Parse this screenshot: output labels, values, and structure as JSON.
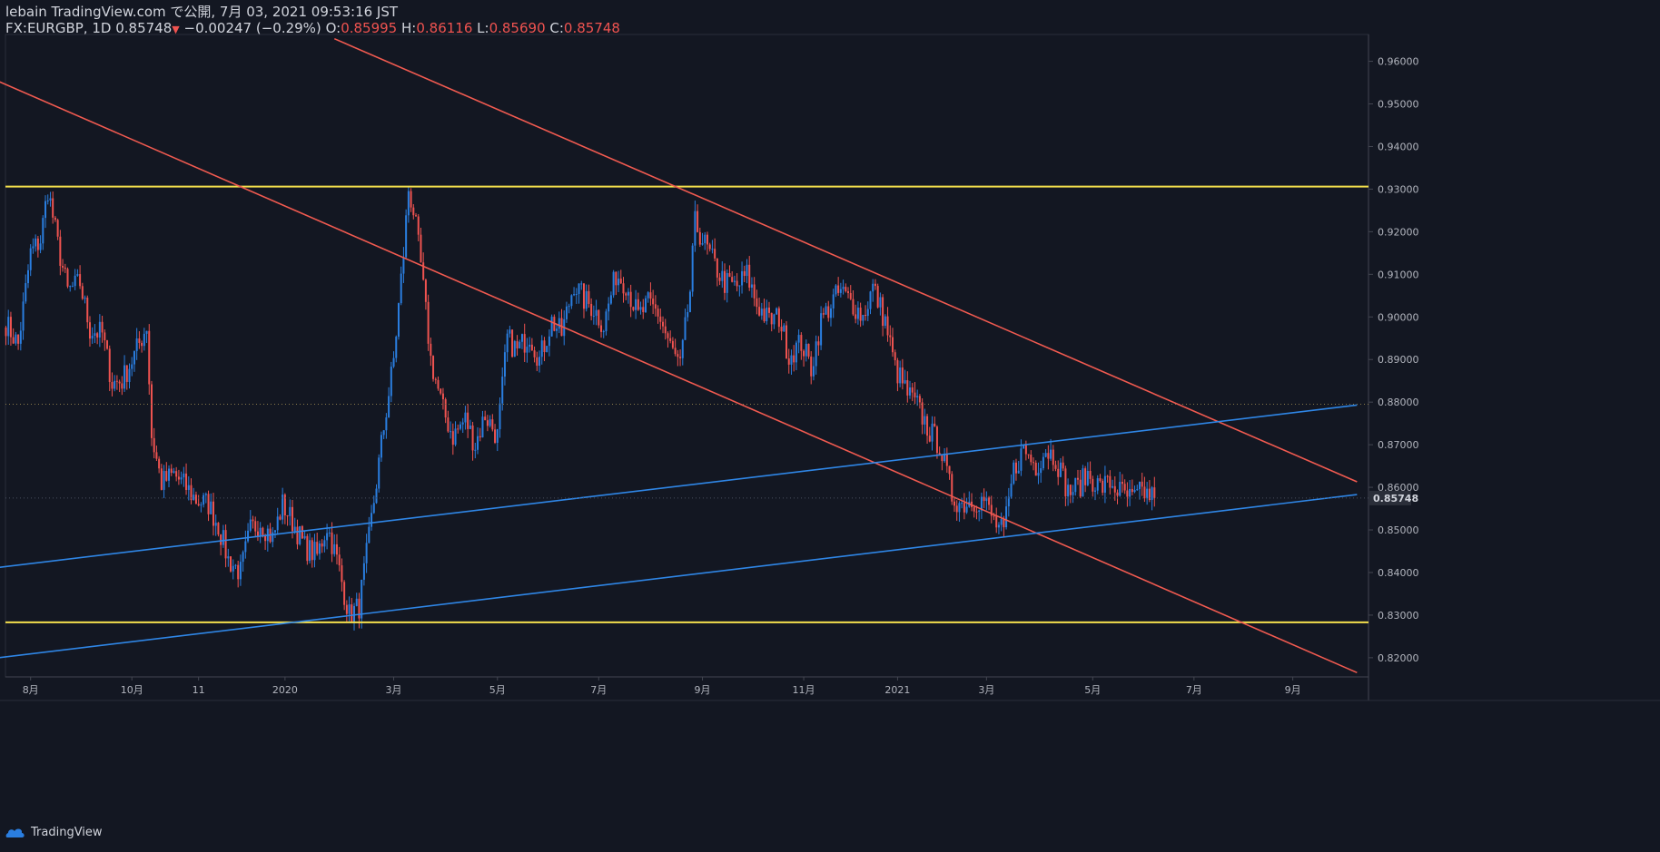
{
  "header": {
    "line1": "lebain TradingView.com で公開, 7月 03, 2021 09:53:16 JST",
    "symbol": "FX:EURGBP, 1D",
    "last": "0.85748",
    "arrow": "▼",
    "change": "−0.00247 (−0.29%)",
    "o_label": "O:",
    "o_value": "0.85995",
    "h_label": "H:",
    "h_value": "0.86116",
    "l_label": "L:",
    "l_value": "0.85690",
    "c_label": "C:",
    "c_value": "0.85748"
  },
  "footer": {
    "brand": "TradingView"
  },
  "colors": {
    "background": "#131722",
    "up": "#2a7ee0",
    "down": "#ef5350",
    "yellow": "#f4e04d",
    "blueLine": "#2f86e6",
    "redLine": "#f05a50",
    "axisText": "#b2b5be"
  },
  "chart_data": {
    "type": "candlestick",
    "symbol": "FX:EURGBP",
    "interval": "1D",
    "ylim": [
      0.8155,
      0.9663
    ],
    "y_ticks": [
      "0.96000",
      "0.95000",
      "0.94000",
      "0.93000",
      "0.92000",
      "0.91000",
      "0.90000",
      "0.89000",
      "0.88000",
      "0.87000",
      "0.86000",
      "0.85000",
      "0.84000",
      "0.83000",
      "0.82000"
    ],
    "x_ticks": [
      "8月",
      "10月",
      "11",
      "2020",
      "3月",
      "5月",
      "7月",
      "9月",
      "11月",
      "2021",
      "3月",
      "5月",
      "7月",
      "9月"
    ],
    "last_price_label": "0.85748",
    "series_points": [
      [
        0,
        0.8985
      ],
      [
        5,
        0.8935
      ],
      [
        10,
        0.915
      ],
      [
        14,
        0.918
      ],
      [
        17,
        0.93
      ],
      [
        21,
        0.917
      ],
      [
        25,
        0.906
      ],
      [
        30,
        0.908
      ],
      [
        34,
        0.897
      ],
      [
        39,
        0.896
      ],
      [
        43,
        0.8845
      ],
      [
        47,
        0.885
      ],
      [
        52,
        0.891
      ],
      [
        57,
        0.898
      ],
      [
        59,
        0.872
      ],
      [
        63,
        0.861
      ],
      [
        68,
        0.863
      ],
      [
        73,
        0.86
      ],
      [
        77,
        0.857
      ],
      [
        82,
        0.856
      ],
      [
        86,
        0.851
      ],
      [
        90,
        0.843
      ],
      [
        95,
        0.84
      ],
      [
        99,
        0.85
      ],
      [
        103,
        0.852
      ],
      [
        108,
        0.848
      ],
      [
        112,
        0.856
      ],
      [
        116,
        0.852
      ],
      [
        121,
        0.846
      ],
      [
        126,
        0.844
      ],
      [
        130,
        0.851
      ],
      [
        134,
        0.843
      ],
      [
        139,
        0.83
      ],
      [
        143,
        0.832
      ],
      [
        147,
        0.848
      ],
      [
        152,
        0.87
      ],
      [
        157,
        0.89
      ],
      [
        161,
        0.915
      ],
      [
        163,
        0.93
      ],
      [
        165,
        0.925
      ],
      [
        168,
        0.912
      ],
      [
        172,
        0.89
      ],
      [
        177,
        0.878
      ],
      [
        181,
        0.872
      ],
      [
        186,
        0.876
      ],
      [
        190,
        0.87
      ],
      [
        194,
        0.877
      ],
      [
        199,
        0.872
      ],
      [
        203,
        0.895
      ],
      [
        207,
        0.892
      ],
      [
        212,
        0.896
      ],
      [
        216,
        0.89
      ],
      [
        221,
        0.899
      ],
      [
        225,
        0.896
      ],
      [
        230,
        0.908
      ],
      [
        234,
        0.904
      ],
      [
        238,
        0.902
      ],
      [
        242,
        0.898
      ],
      [
        247,
        0.91
      ],
      [
        251,
        0.908
      ],
      [
        256,
        0.9
      ],
      [
        260,
        0.903
      ],
      [
        264,
        0.901
      ],
      [
        269,
        0.893
      ],
      [
        273,
        0.888
      ],
      [
        277,
        0.906
      ],
      [
        279,
        0.922
      ],
      [
        283,
        0.917
      ],
      [
        287,
        0.912
      ],
      [
        291,
        0.908
      ],
      [
        296,
        0.907
      ],
      [
        300,
        0.91
      ],
      [
        304,
        0.903
      ],
      [
        309,
        0.899
      ],
      [
        313,
        0.9
      ],
      [
        317,
        0.891
      ],
      [
        322,
        0.894
      ],
      [
        326,
        0.888
      ],
      [
        330,
        0.899
      ],
      [
        335,
        0.904
      ],
      [
        338,
        0.906
      ],
      [
        343,
        0.903
      ],
      [
        347,
        0.9
      ],
      [
        351,
        0.907
      ],
      [
        356,
        0.899
      ],
      [
        360,
        0.888
      ],
      [
        365,
        0.882
      ],
      [
        369,
        0.879
      ],
      [
        374,
        0.873
      ],
      [
        378,
        0.87
      ],
      [
        383,
        0.858
      ],
      [
        387,
        0.856
      ],
      [
        391,
        0.857
      ],
      [
        396,
        0.857
      ],
      [
        400,
        0.852
      ],
      [
        404,
        0.849
      ],
      [
        408,
        0.864
      ],
      [
        412,
        0.869
      ],
      [
        417,
        0.865
      ],
      [
        421,
        0.869
      ],
      [
        425,
        0.867
      ],
      [
        430,
        0.859
      ],
      [
        434,
        0.86
      ],
      [
        438,
        0.863
      ],
      [
        443,
        0.86
      ],
      [
        447,
        0.861
      ],
      [
        451,
        0.859
      ],
      [
        456,
        0.857
      ],
      [
        460,
        0.859
      ],
      [
        465,
        0.8575
      ]
    ],
    "horizontal_lines": [
      {
        "name": "resistance",
        "price": 0.9306,
        "color": "yellow"
      },
      {
        "name": "support",
        "price": 0.8283,
        "color": "yellow"
      },
      {
        "name": "reference",
        "price": 0.8795,
        "style": "dotted"
      }
    ],
    "trend_lines": [
      {
        "color": "red",
        "from": [
          -3,
          0.9553
        ],
        "to": [
          547,
          0.8165
        ]
      },
      {
        "color": "red",
        "from": [
          133,
          0.9653
        ],
        "to": [
          547,
          0.8613
        ]
      },
      {
        "color": "blue",
        "from": [
          -3,
          0.8412
        ],
        "to": [
          547,
          0.8793
        ]
      },
      {
        "color": "blue",
        "from": [
          -3,
          0.82
        ],
        "to": [
          547,
          0.8583
        ]
      }
    ],
    "grid": false,
    "legend": "none"
  }
}
